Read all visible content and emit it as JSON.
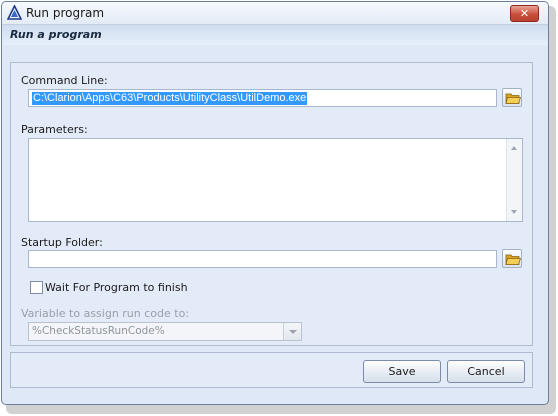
{
  "window": {
    "title": "Run program",
    "close_label": "✕",
    "header": "Run a program"
  },
  "form": {
    "command_line": {
      "label": "Command Line:",
      "value": "C:\\Clarion\\Apps\\C63\\Products\\UtilityClass\\UtilDemo.exe"
    },
    "parameters": {
      "label": "Parameters:",
      "value": ""
    },
    "startup_folder": {
      "label": "Startup Folder:",
      "value": ""
    },
    "wait_checkbox": {
      "label": "Wait For Program to finish",
      "checked": false
    },
    "run_code": {
      "label": "Variable to assign run code to:",
      "value": "%CheckStatusRunCode%"
    }
  },
  "buttons": {
    "save": "Save",
    "cancel": "Cancel"
  },
  "icons": {
    "app": "triangle-app-icon",
    "browse": "folder-icon",
    "close": "close-icon",
    "dropdown": "chevron-down-icon"
  },
  "colors": {
    "selection": "#3399ff",
    "close_button": "#c9503c",
    "dialog_bg": "#dfe8f6"
  }
}
